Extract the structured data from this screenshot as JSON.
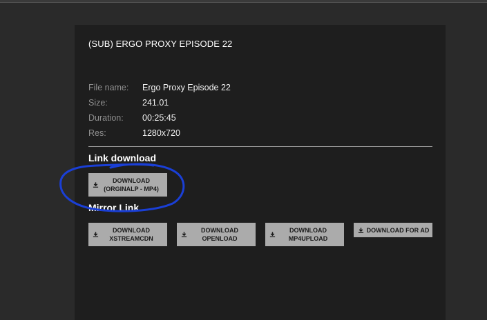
{
  "title": "(SUB) ERGO PROXY EPISODE 22",
  "info": [
    {
      "label": "File name:",
      "value": "Ergo Proxy Episode 22"
    },
    {
      "label": "Size:",
      "value": "241.01"
    },
    {
      "label": "Duration:",
      "value": "00:25:45"
    },
    {
      "label": "Res:",
      "value": "1280x720"
    }
  ],
  "link_download": {
    "heading": "Link download",
    "button": {
      "line1": "DOWNLOAD",
      "line2": "(ORGINALP - MP4)"
    }
  },
  "mirror_link": {
    "heading": "Mirror Link",
    "buttons": [
      {
        "line1": "DOWNLOAD",
        "line2": "XSTREAMCDN"
      },
      {
        "line1": "DOWNLOAD",
        "line2": "OPENLOAD"
      },
      {
        "line1": "DOWNLOAD",
        "line2": "MP4UPLOAD"
      },
      {
        "line1": "DOWNLOAD FOR AD",
        "line2": ""
      }
    ]
  },
  "icons": {
    "download": "download-icon"
  },
  "colors": {
    "background": "#2a2a2a",
    "panel": "#1e1e1e",
    "button": "#ababab",
    "annotation": "#1a3fd6"
  }
}
